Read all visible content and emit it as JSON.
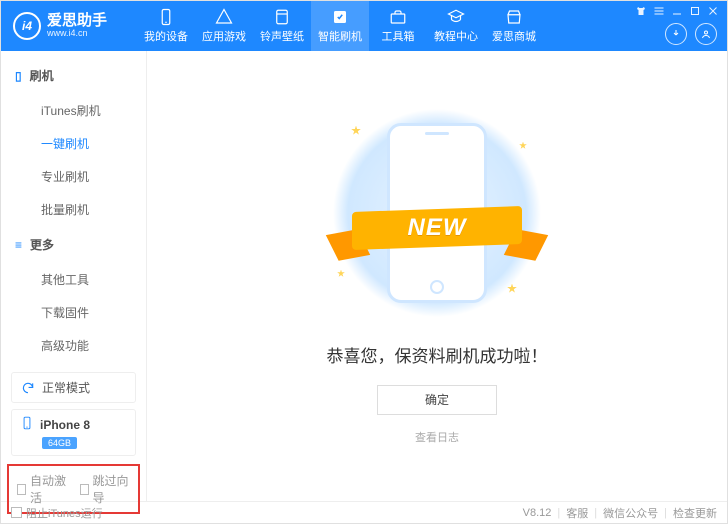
{
  "colors": {
    "primary": "#1e88ff",
    "accent": "#ffb300",
    "highlight_border": "#e53935"
  },
  "header": {
    "app_name": "爱思助手",
    "app_url": "www.i4.cn",
    "nav": [
      {
        "label": "我的设备"
      },
      {
        "label": "应用游戏"
      },
      {
        "label": "铃声壁纸"
      },
      {
        "label": "智能刷机",
        "active": true
      },
      {
        "label": "工具箱"
      },
      {
        "label": "教程中心"
      },
      {
        "label": "爱思商城"
      }
    ]
  },
  "sidebar": {
    "section1": {
      "title": "刷机",
      "items": [
        {
          "label": "iTunes刷机"
        },
        {
          "label": "一键刷机",
          "active": true
        },
        {
          "label": "专业刷机"
        },
        {
          "label": "批量刷机"
        }
      ]
    },
    "section2": {
      "title": "更多",
      "items": [
        {
          "label": "其他工具"
        },
        {
          "label": "下载固件"
        },
        {
          "label": "高级功能"
        }
      ]
    },
    "mode": "正常模式",
    "device": {
      "name": "iPhone 8",
      "storage": "64GB"
    },
    "options": {
      "auto_activate": "自动激活",
      "skip_guide": "跳过向导"
    }
  },
  "main": {
    "ribbon_text": "NEW",
    "message": "恭喜您，保资料刷机成功啦！",
    "ok_label": "确定",
    "log_label": "查看日志"
  },
  "footer": {
    "block_itunes": "阻止iTunes运行",
    "version": "V8.12",
    "links": [
      "客服",
      "微信公众号",
      "检查更新"
    ]
  }
}
